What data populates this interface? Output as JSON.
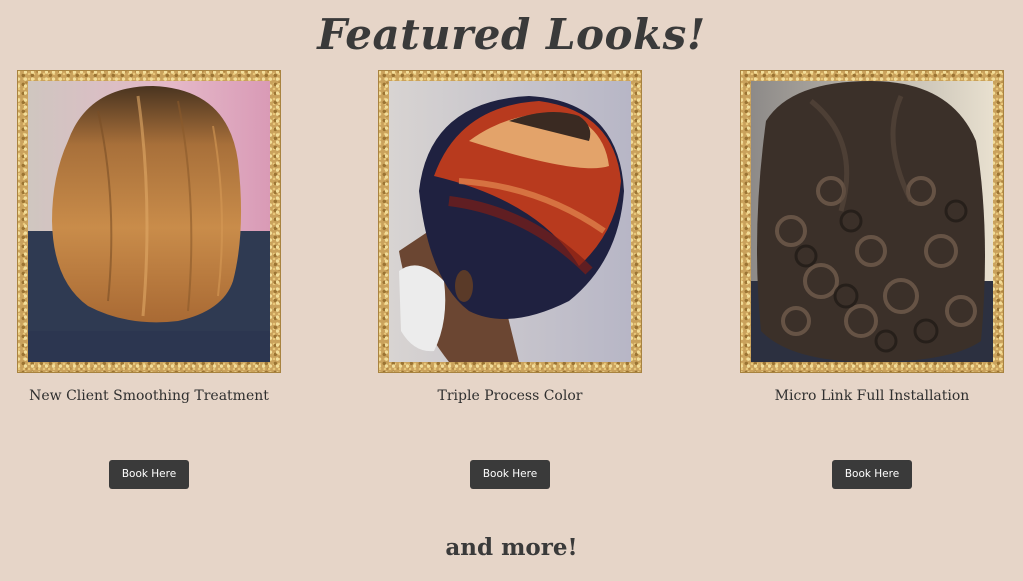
{
  "section": {
    "title": "Featured Looks!",
    "footer_text": "and more!"
  },
  "cards": [
    {
      "title": "New Client Smoothing Treatment",
      "button_label": "Book Here",
      "image_subject": "hair-bob-photo"
    },
    {
      "title": "Triple Process Color",
      "button_label": "Book Here",
      "image_subject": "hair-color-photo"
    },
    {
      "title": "Micro Link Full Installation",
      "button_label": "Book Here",
      "image_subject": "hair-curls-photo"
    }
  ],
  "colors": {
    "background": "#e6d5c8",
    "frame_gold": "#caa25c",
    "button": "#3a3a3a",
    "text": "#2f2f2f"
  }
}
